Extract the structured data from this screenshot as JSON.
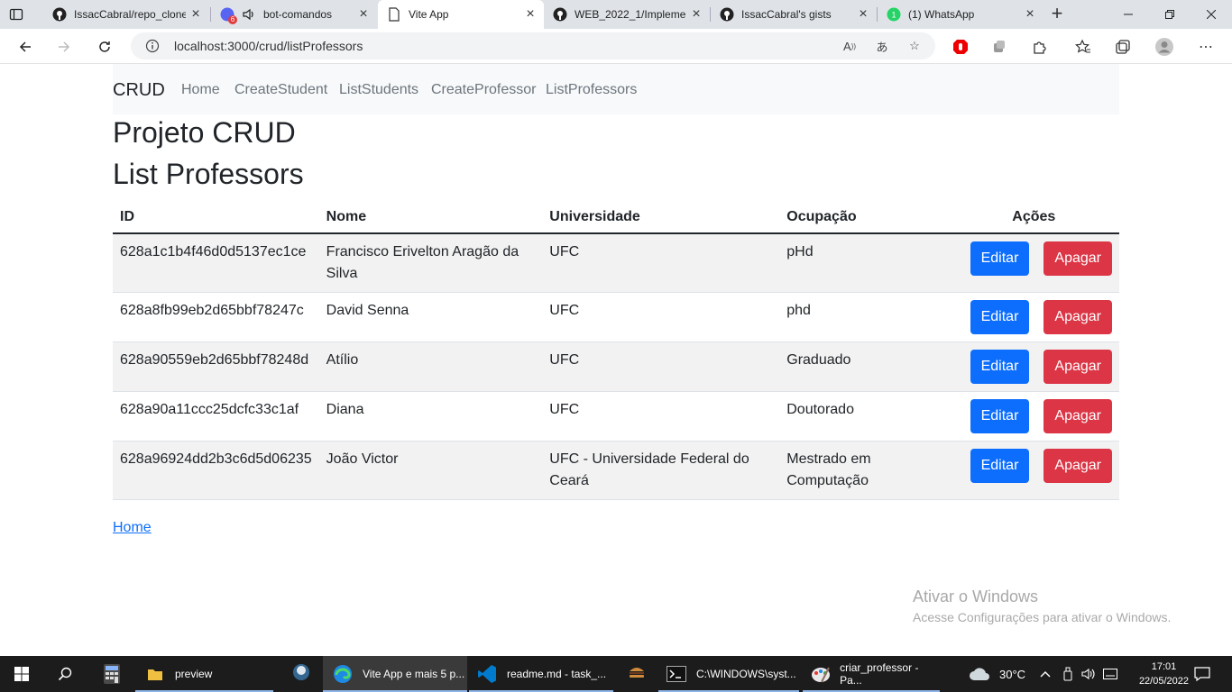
{
  "browser": {
    "tabs": [
      {
        "title": "IssacCabral/repo_clone",
        "icon": "github-icon",
        "active": false
      },
      {
        "title": "bot-comandos",
        "icon": "speaker-icon",
        "active": false
      },
      {
        "title": "Vite App",
        "icon": "page-icon",
        "active": true
      },
      {
        "title": "WEB_2022_1/Impleme",
        "icon": "github-icon",
        "active": false
      },
      {
        "title": "IssacCabral's gists",
        "icon": "github-icon",
        "active": false
      },
      {
        "title": "(1) WhatsApp",
        "icon": "whatsapp-icon",
        "active": false
      }
    ],
    "notif_badge": "6",
    "address": "localhost:3000/crud/listProfessors"
  },
  "app": {
    "brand": "CRUD",
    "nav": [
      "Home",
      "CreateStudent",
      "ListStudents",
      "CreateProfessor",
      "ListProfessors"
    ],
    "title": "Projeto CRUD",
    "subtitle": "List Professors",
    "table": {
      "headers": [
        "ID",
        "Nome",
        "Universidade",
        "Ocupação",
        "Ações"
      ],
      "rows": [
        {
          "id": "628a1c1b4f46d0d5137ec1ce",
          "nome": "Francisco Erivelton Aragão da Silva",
          "universidade": "UFC",
          "ocupacao": "pHd"
        },
        {
          "id": "628a8fb99eb2d65bbf78247c",
          "nome": "David Senna",
          "universidade": "UFC",
          "ocupacao": "phd"
        },
        {
          "id": "628a90559eb2d65bbf78248d",
          "nome": "Atílio",
          "universidade": "UFC",
          "ocupacao": "Graduado"
        },
        {
          "id": "628a90a11ccc25dcfc33c1af",
          "nome": "Diana",
          "universidade": "UFC",
          "ocupacao": "Doutorado"
        },
        {
          "id": "628a96924dd2b3c6d5d06235",
          "nome": "João Victor",
          "universidade": "UFC - Universidade Federal do Ceará",
          "ocupacao": "Mestrado em Computação"
        }
      ],
      "edit_label": "Editar",
      "delete_label": "Apagar"
    },
    "home_link": "Home"
  },
  "watermark": {
    "title": "Ativar o Windows",
    "subtitle": "Acesse Configurações para ativar o Windows."
  },
  "taskbar": {
    "items": [
      {
        "label": "preview",
        "icon": "folder-icon"
      },
      {
        "label": "Vite App e mais 5 p...",
        "icon": "edge-icon"
      },
      {
        "label": "readme.md - task_...",
        "icon": "vscode-icon"
      },
      {
        "label": "C:\\WINDOWS\\syst...",
        "icon": "terminal-icon"
      },
      {
        "label": "criar_professor - Pa...",
        "icon": "paint-icon"
      }
    ],
    "weather": "30°C",
    "time": "17:01",
    "date": "22/05/2022"
  },
  "colors": {
    "primary": "#0d6efd",
    "danger": "#dc3545",
    "navbar_bg": "#f8f9fa",
    "stripe": "#f2f2f2"
  }
}
